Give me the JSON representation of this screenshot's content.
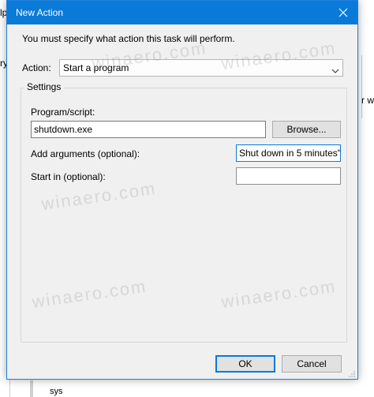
{
  "background": {
    "left_fragment_1": "lp",
    "left_fragment_2": "ry",
    "right_fragment": "r wh",
    "bottom_fragment": "sys"
  },
  "dialog": {
    "title": "New Action",
    "close_icon": "close-icon",
    "instruction": "You must specify what action this task will perform.",
    "action_label": "Action:",
    "action_value": "Start a program",
    "settings_label": "Settings",
    "program_label": "Program/script:",
    "program_value": "shutdown.exe",
    "browse_label": "Browse...",
    "arguments_label": "Add arguments (optional):",
    "arguments_value": "Shut down in 5 minutes\"",
    "start_in_label": "Start in (optional):",
    "start_in_value": "",
    "ok_label": "OK",
    "cancel_label": "Cancel"
  },
  "watermark": "winaero.com",
  "colors": {
    "titlebar": "#0a7ad8",
    "dialog_bg": "#f0f0f0",
    "button_bg": "#e1e1e1",
    "focus_border": "#0a7ad8"
  }
}
